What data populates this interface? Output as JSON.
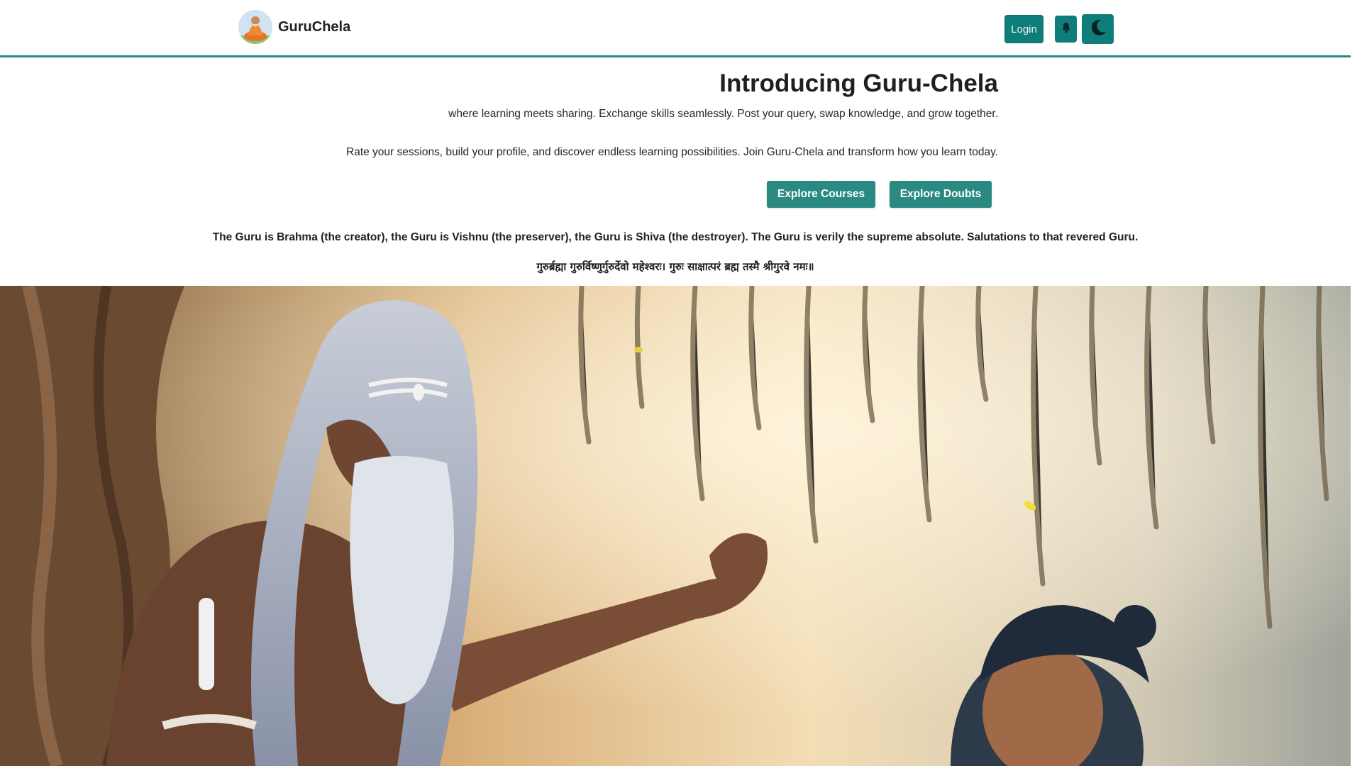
{
  "navbar": {
    "brand_name": "GuruChela",
    "login_label": "Login",
    "bell_icon": "bell-icon",
    "theme_icon": "moon-icon",
    "accent": "#2a8a82"
  },
  "hero": {
    "title": "Introducing Guru-Chela",
    "subtitle_1": "where learning meets sharing. Exchange skills seamlessly. Post your query, swap knowledge, and grow together.",
    "subtitle_2": "Rate your sessions, build your profile, and discover endless learning possibilities. Join Guru-Chela and transform how you learn today.",
    "cta_courses": "Explore Courses",
    "cta_doubts": "Explore Doubts",
    "button_color": "#2a8a82"
  },
  "quote": {
    "english": "The Guru is Brahma (the creator), the Guru is Vishnu (the preserver), the Guru is Shiva (the destroyer). The Guru is verily the supreme absolute. Salutations to that revered Guru.",
    "sanskrit": "गुरुर्ब्रह्मा गुरुर्विष्णुर्गुरुर्देवो महेश्वरः। गुरुः साक्षात्परं ब्रह्म तस्मै श्रीगुरवे नमः॥"
  }
}
